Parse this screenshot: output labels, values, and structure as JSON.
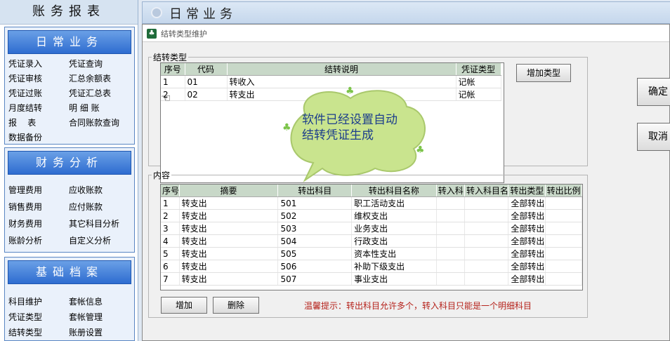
{
  "nav": {
    "title": "账务报表",
    "sections": [
      {
        "label": "日常业务",
        "links": [
          "凭证录入",
          "凭证查询",
          "凭证审核",
          "汇总余额表",
          "凭证过账",
          "凭证汇总表",
          "月度结转",
          "明 细 账",
          "报    表",
          "合同账款查询",
          "数据备份"
        ]
      },
      {
        "label": "财务分析",
        "links": [
          "管理费用",
          "应收账款",
          "销售费用",
          "应付账款",
          "财务费用",
          "其它科目分析",
          "账龄分析",
          "自定义分析"
        ]
      },
      {
        "label": "基础档案",
        "links": [
          "科目维护",
          "套帐信息",
          "凭证类型",
          "套帐管理",
          "结转类型",
          "账册设置"
        ]
      }
    ]
  },
  "header": {
    "title": "日常业务"
  },
  "window": {
    "title": "结转类型维护",
    "type_group": {
      "legend": "结转类型",
      "columns": [
        "序号",
        "代码",
        "结转说明",
        "凭证类型"
      ],
      "rows": [
        [
          "1",
          "01",
          "转收入",
          "记帐"
        ],
        [
          "2",
          "02",
          "转支出",
          "记帐"
        ]
      ],
      "add_type_label": "增加类型"
    },
    "content_group": {
      "legend": "内容",
      "columns": [
        "序号",
        "摘要",
        "转出科目",
        "转出科目名称",
        "转入科目",
        "转入科目名称",
        "转出类型",
        "转出比例"
      ],
      "rows": [
        [
          "1",
          "转支出",
          "501",
          "职工活动支出",
          "",
          "",
          "全部转出",
          ""
        ],
        [
          "2",
          "转支出",
          "502",
          "维权支出",
          "",
          "",
          "全部转出",
          ""
        ],
        [
          "3",
          "转支出",
          "503",
          "业务支出",
          "",
          "",
          "全部转出",
          ""
        ],
        [
          "4",
          "转支出",
          "504",
          "行政支出",
          "",
          "",
          "全部转出",
          ""
        ],
        [
          "5",
          "转支出",
          "505",
          "资本性支出",
          "",
          "",
          "全部转出",
          ""
        ],
        [
          "6",
          "转支出",
          "506",
          "补助下级支出",
          "",
          "",
          "全部转出",
          ""
        ],
        [
          "7",
          "转支出",
          "507",
          "事业支出",
          "",
          "",
          "全部转出",
          ""
        ]
      ],
      "add_label": "增加",
      "delete_label": "删除",
      "hint": "温馨提示：转出科目允许多个，转入科目只能是一个明细科目"
    },
    "confirm_label": "确定",
    "cancel_label": "取消"
  },
  "bubble": {
    "text": "软件已经设置自动结转凭证生成",
    "color": "#c9e48e"
  }
}
